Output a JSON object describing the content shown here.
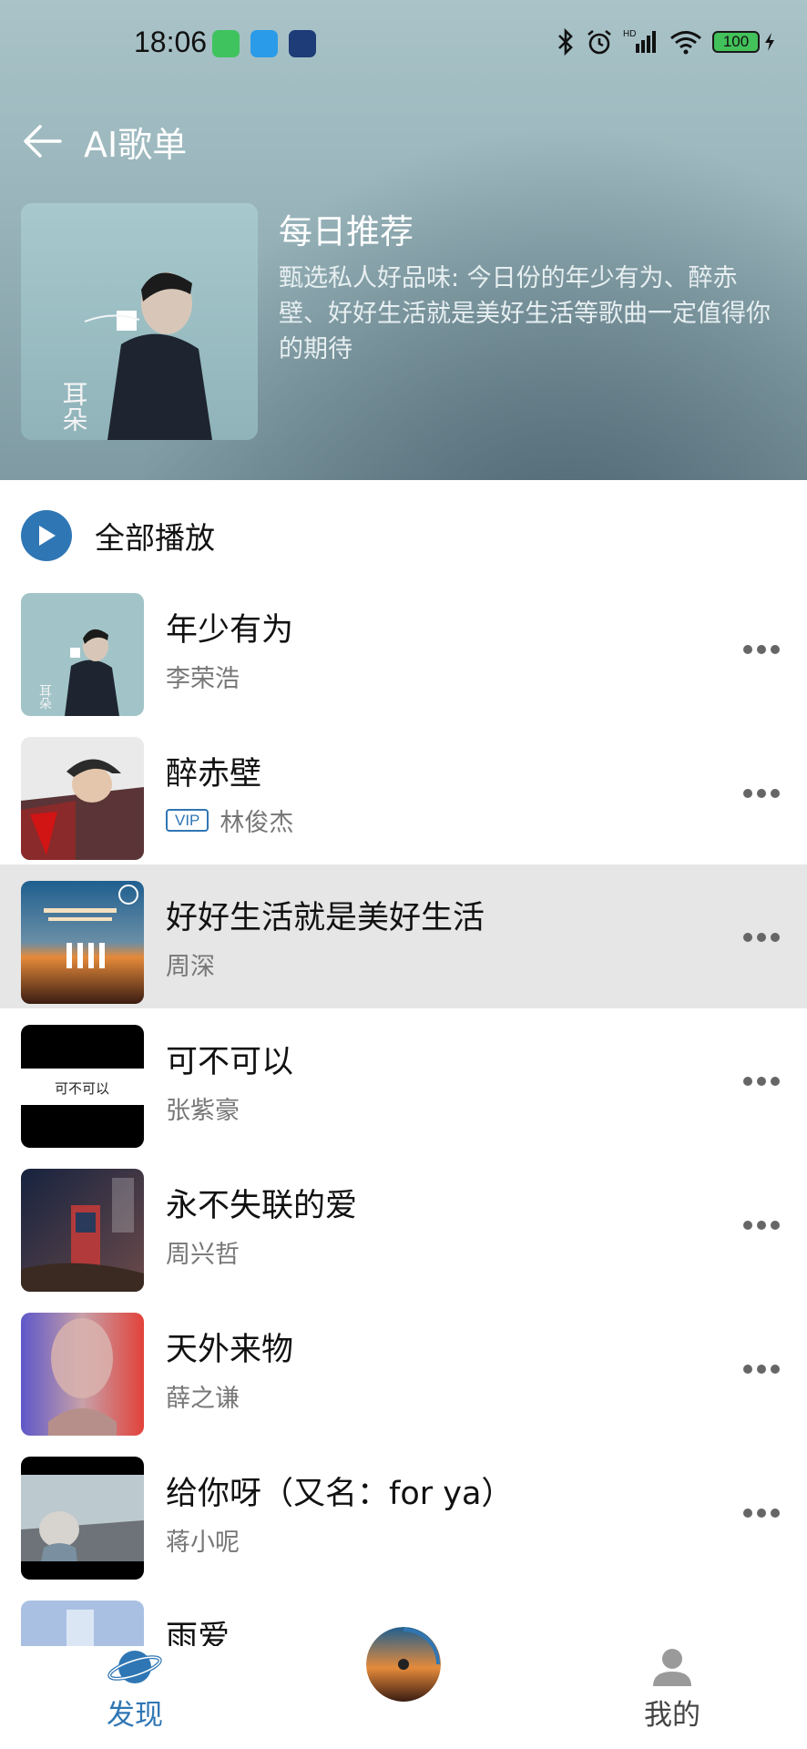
{
  "status_bar": {
    "time": "18:06",
    "battery": "100",
    "network_label": "HD"
  },
  "header": {
    "title": "AI歌单"
  },
  "playlist": {
    "heading": "每日推荐",
    "description": "甄选私人好品味: 今日份的年少有为、醉赤壁、好好生活就是美好生活等歌曲一定值得你的期待",
    "cover_text": "耳朵"
  },
  "play_all": {
    "label": "全部播放"
  },
  "songs": [
    {
      "title": "年少有为",
      "artist": "李荣浩",
      "vip": false
    },
    {
      "title": "醉赤壁",
      "artist": "林俊杰",
      "vip": true,
      "vip_label": "VIP"
    },
    {
      "title": "好好生活就是美好生活",
      "artist": "周深",
      "vip": false
    },
    {
      "title": "可不可以",
      "artist": "张紫豪",
      "vip": false,
      "cover_text": "可不可以"
    },
    {
      "title": "永不失联的爱",
      "artist": "周兴哲",
      "vip": false
    },
    {
      "title": "天外来物",
      "artist": "薛之谦",
      "vip": false
    },
    {
      "title": "给你呀（又名：for ya）",
      "artist": "蒋小呢",
      "vip": false
    },
    {
      "title": "雨爱",
      "artist": "",
      "vip": false
    }
  ],
  "bottom_nav": {
    "discover_label": "发现",
    "mine_label": "我的"
  },
  "colors": {
    "accent": "#2f76b4",
    "highlight_row": "#e6e6e6"
  }
}
